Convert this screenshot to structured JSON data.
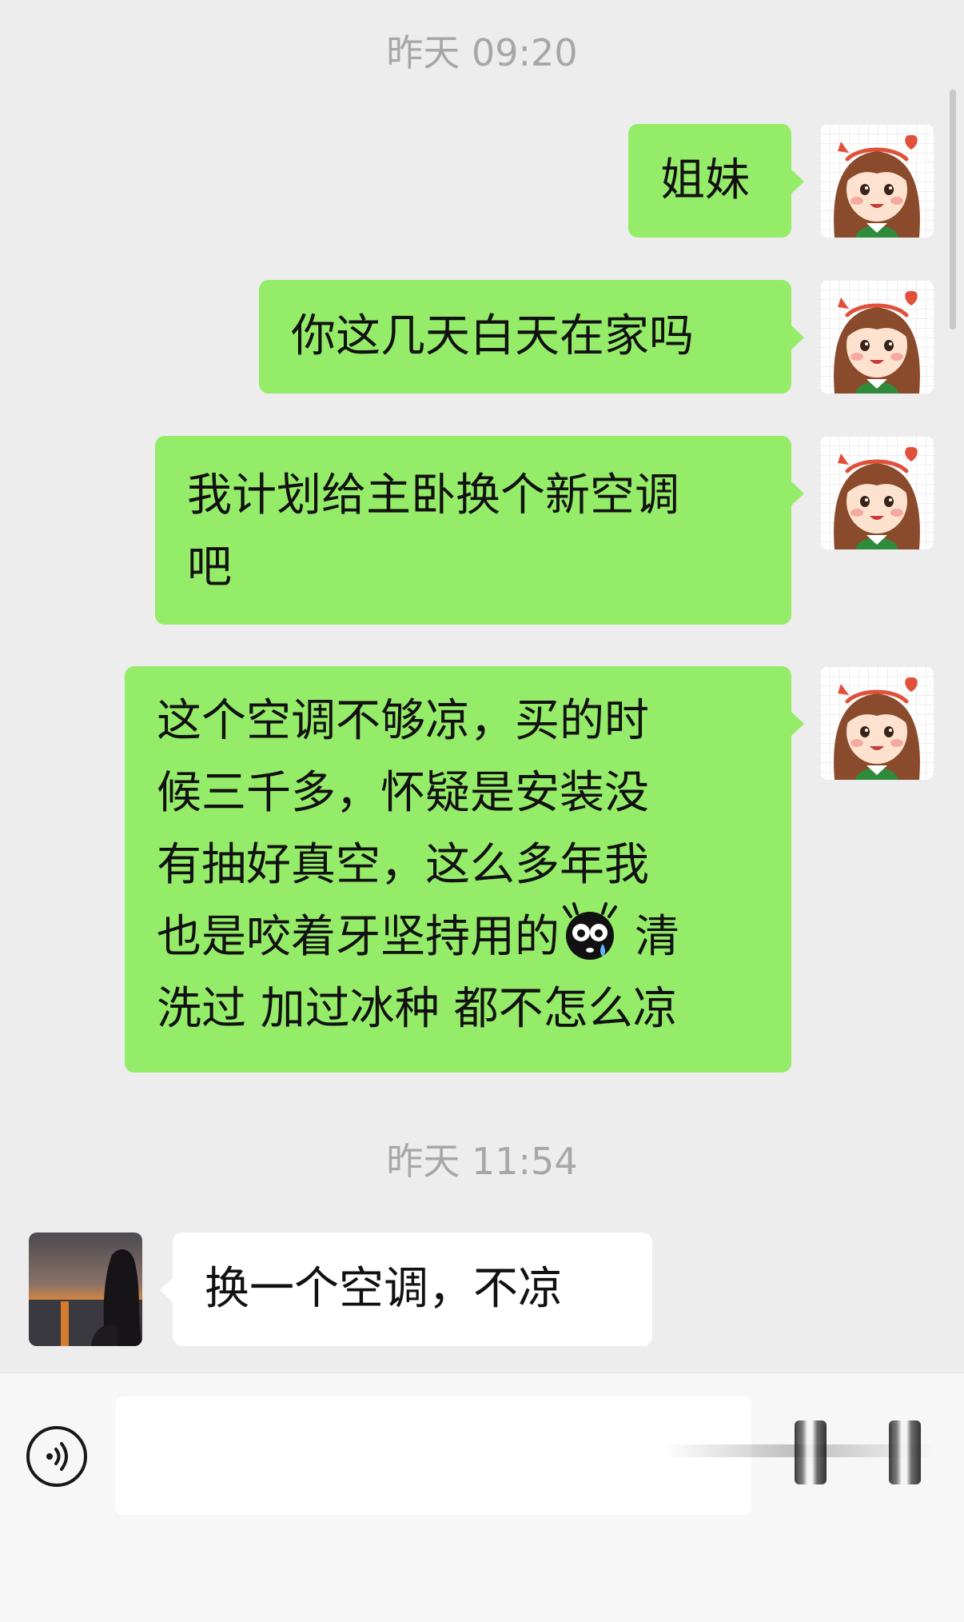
{
  "timestamps": [
    "昨天 09:20",
    "昨天 11:54"
  ],
  "messages": [
    {
      "side": "me",
      "text": "姐妹"
    },
    {
      "side": "me",
      "text": "你这几天白天在家吗"
    },
    {
      "side": "me",
      "lines": [
        "我计划给主卧换个新空调",
        "吧"
      ]
    },
    {
      "side": "me",
      "lines": [
        "这个空调不够凉，买的时",
        "候三千多，怀疑是安装没",
        "有抽好真空，这么多年我",
        "也是咬着牙坚持用的",
        "清",
        "洗过 加过冰种 都不怎么凉"
      ]
    },
    {
      "side": "other",
      "text": "换一个空调，不凉"
    }
  ],
  "icons": {
    "my_avatar": "cartoon-girl-avatar",
    "contact_avatar": "sunset-photo-avatar",
    "emoji": "crying-emoji",
    "voice": "voice-icon"
  },
  "colors": {
    "background": "#ededed",
    "my_bubble": "#95ec69",
    "their_bubble": "#ffffff",
    "timestamp": "#a7a7a7"
  },
  "input": {
    "value": "",
    "placeholder": ""
  }
}
